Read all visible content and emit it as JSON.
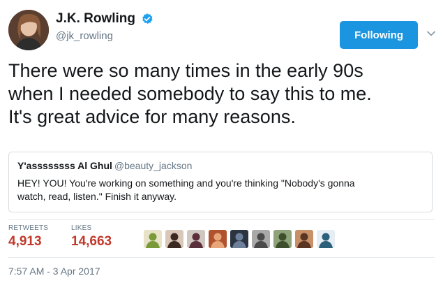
{
  "author": {
    "display_name": "J.K. Rowling",
    "handle": "@jk_rowling",
    "verified": true,
    "avatar_icon": "author-avatar"
  },
  "follow_button": {
    "label": "Following",
    "color": "#1b95e0"
  },
  "menu": {
    "icon": "chevron-down-icon"
  },
  "tweet": {
    "text": "There were so many times in the early 90s\nwhen I needed somebody to say this to me.\nIt's great advice for many reasons."
  },
  "quoted_tweet": {
    "display_name": "Y'assssssss Al Ghul",
    "handle": "@beauty_jackson",
    "text": "HEY! YOU! You're working on something and you're thinking \"Nobody's gonna\nwatch, read, listen.\" Finish it anyway."
  },
  "stats": {
    "retweets_label": "RETWEETS",
    "retweets_value": "4,913",
    "likes_label": "LIKES",
    "likes_value": "14,663",
    "count_color": "#c0392b"
  },
  "likers": [
    {
      "name": "liker-avatar-1",
      "bg": "#e8e2c9",
      "fg": "#7a9a3a"
    },
    {
      "name": "liker-avatar-2",
      "bg": "#d9c7b8",
      "fg": "#3b2a22"
    },
    {
      "name": "liker-avatar-3",
      "bg": "#cfc7c0",
      "fg": "#5a2e3a"
    },
    {
      "name": "liker-avatar-4",
      "bg": "#b0522e",
      "fg": "#e8a57a"
    },
    {
      "name": "liker-avatar-5",
      "bg": "#2b3440",
      "fg": "#6d7f9a"
    },
    {
      "name": "liker-avatar-6",
      "bg": "#a9a9a9",
      "fg": "#4a4a4a"
    },
    {
      "name": "liker-avatar-7",
      "bg": "#8fa37a",
      "fg": "#3e4f2e"
    },
    {
      "name": "liker-avatar-8",
      "bg": "#c79066",
      "fg": "#5b3524"
    },
    {
      "name": "liker-avatar-9",
      "bg": "#e7eef3",
      "fg": "#2b5f7a"
    }
  ],
  "timestamp": "7:57 AM - 3 Apr 2017"
}
